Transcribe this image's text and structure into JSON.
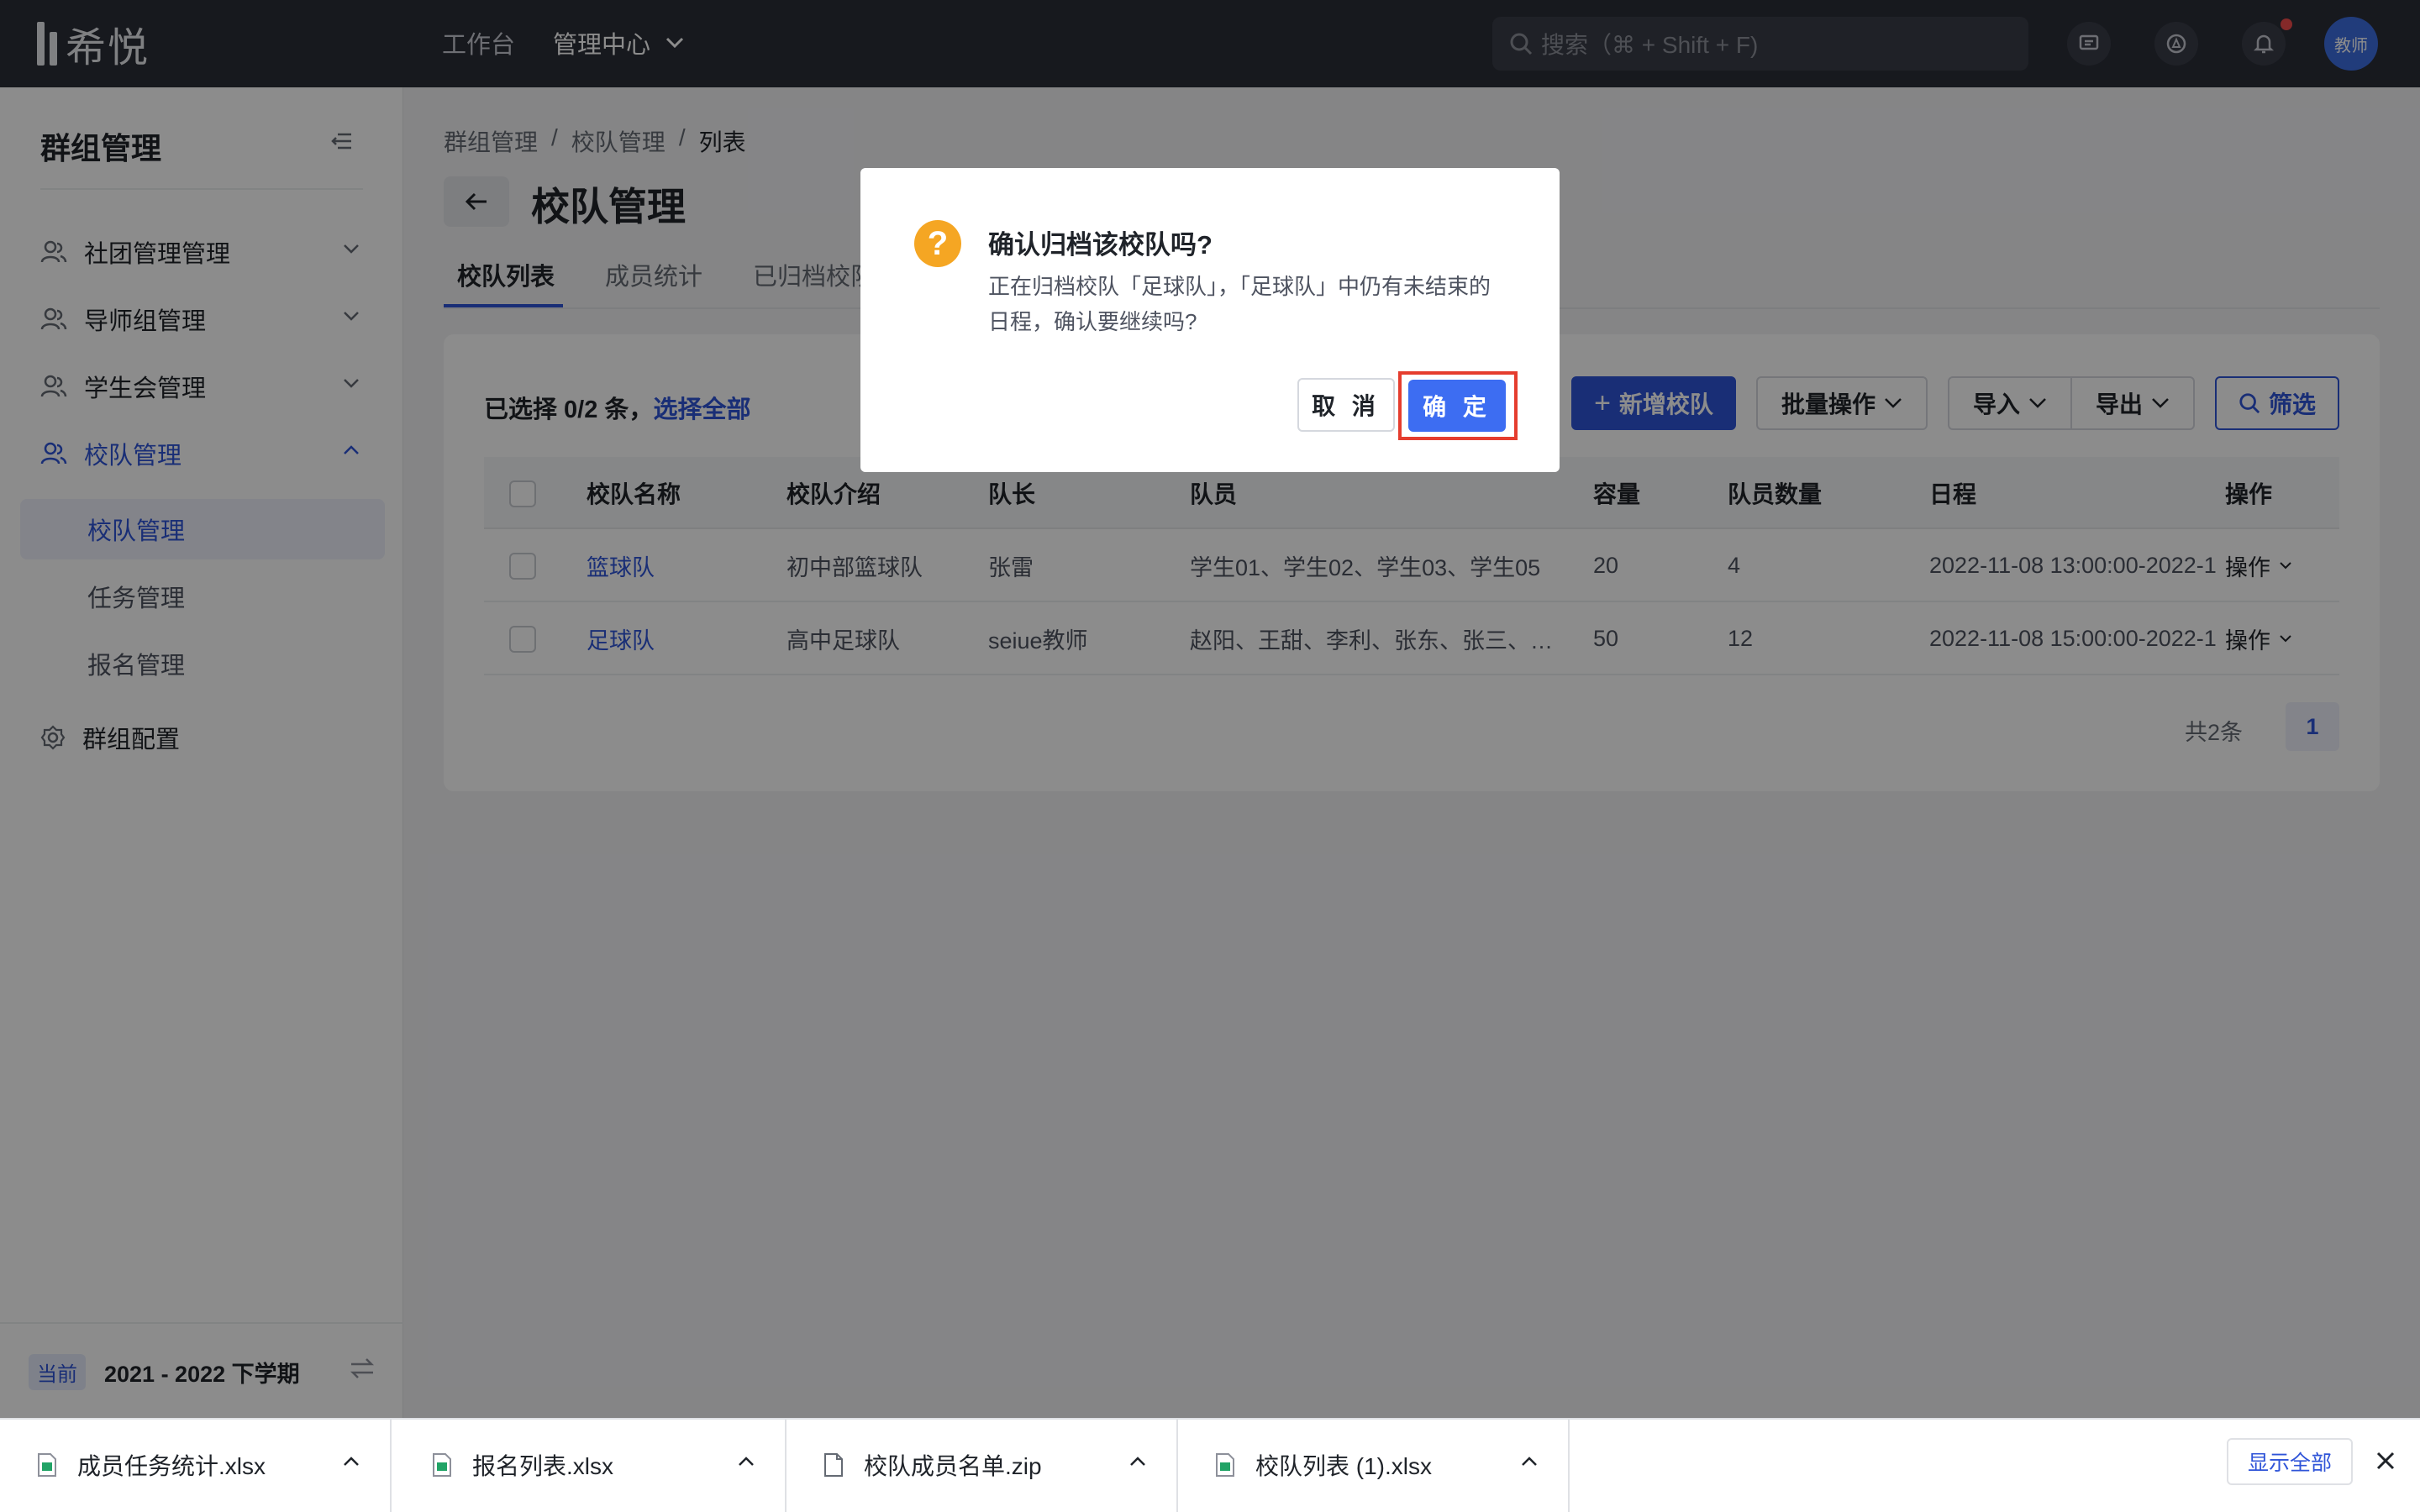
{
  "app": {
    "logo_text": "希悦"
  },
  "topnav": {
    "workbench": "工作台",
    "admin_center": "管理中心",
    "search_placeholder": "搜索（⌘ + Shift + F)",
    "avatar_label": "教师"
  },
  "sidebar": {
    "title": "群组管理",
    "menus": [
      {
        "label": "社团管理管理"
      },
      {
        "label": "导师组管理"
      },
      {
        "label": "学生会管理"
      },
      {
        "label": "校队管理"
      }
    ],
    "sub_items": [
      {
        "label": "校队管理"
      },
      {
        "label": "任务管理"
      },
      {
        "label": "报名管理"
      }
    ],
    "config": "群组配置",
    "term_badge": "当前",
    "term": "2021 - 2022 下学期"
  },
  "breadcrumb": [
    "群组管理",
    "/",
    "校队管理",
    "/",
    "列表"
  ],
  "page_title": "校队管理",
  "tabs": [
    "校队列表",
    "成员统计",
    "已归档校队"
  ],
  "toolbar": {
    "selected": "已选择 0/2 条，",
    "select_all": "选择全部",
    "add": "新增校队",
    "batch": "批量操作",
    "import": "导入",
    "export": "导出",
    "filter": "筛选"
  },
  "table": {
    "headers": [
      "校队名称",
      "校队介绍",
      "队长",
      "队员",
      "容量",
      "队员数量",
      "日程",
      "操作"
    ],
    "rows": [
      [
        "篮球队",
        "初中部篮球队",
        "张雷",
        "学生01、学生02、学生03、学生05",
        "20",
        "4",
        "2022-11-08 13:00:00-2022-1",
        "操作"
      ],
      [
        "足球队",
        "高中足球队",
        "seiue教师",
        "赵阳、王甜、李利、张东、张三、…",
        "50",
        "12",
        "2022-11-08 15:00:00-2022-1",
        "操作"
      ]
    ]
  },
  "pagination": {
    "total": "共2条",
    "current": "1"
  },
  "modal": {
    "icon": "?",
    "title": "确认归档该校队吗?",
    "body": "正在归档校队「足球队」，「足球队」中仍有未结束的日程，确认要继续吗?",
    "cancel": "取 消",
    "ok": "确 定"
  },
  "downloads": {
    "items": [
      "成员任务统计.xlsx",
      "报名列表.xlsx",
      "校队成员名单.zip",
      "校队列表 (1).xlsx"
    ],
    "show_all": "显示全部"
  },
  "colors": {
    "primary": "#2f54d8",
    "warning": "#f5a623",
    "highlight": "#e53d2e"
  }
}
